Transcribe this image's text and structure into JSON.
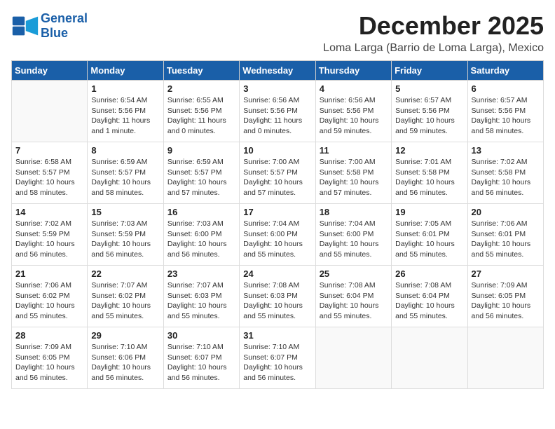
{
  "logo": {
    "text_general": "General",
    "text_blue": "Blue"
  },
  "header": {
    "month": "December 2025",
    "location": "Loma Larga (Barrio de Loma Larga), Mexico"
  },
  "weekdays": [
    "Sunday",
    "Monday",
    "Tuesday",
    "Wednesday",
    "Thursday",
    "Friday",
    "Saturday"
  ],
  "weeks": [
    [
      {
        "day": "",
        "info": ""
      },
      {
        "day": "1",
        "info": "Sunrise: 6:54 AM\nSunset: 5:56 PM\nDaylight: 11 hours\nand 1 minute."
      },
      {
        "day": "2",
        "info": "Sunrise: 6:55 AM\nSunset: 5:56 PM\nDaylight: 11 hours\nand 0 minutes."
      },
      {
        "day": "3",
        "info": "Sunrise: 6:56 AM\nSunset: 5:56 PM\nDaylight: 11 hours\nand 0 minutes."
      },
      {
        "day": "4",
        "info": "Sunrise: 6:56 AM\nSunset: 5:56 PM\nDaylight: 10 hours\nand 59 minutes."
      },
      {
        "day": "5",
        "info": "Sunrise: 6:57 AM\nSunset: 5:56 PM\nDaylight: 10 hours\nand 59 minutes."
      },
      {
        "day": "6",
        "info": "Sunrise: 6:57 AM\nSunset: 5:56 PM\nDaylight: 10 hours\nand 58 minutes."
      }
    ],
    [
      {
        "day": "7",
        "info": "Sunrise: 6:58 AM\nSunset: 5:57 PM\nDaylight: 10 hours\nand 58 minutes."
      },
      {
        "day": "8",
        "info": "Sunrise: 6:59 AM\nSunset: 5:57 PM\nDaylight: 10 hours\nand 58 minutes."
      },
      {
        "day": "9",
        "info": "Sunrise: 6:59 AM\nSunset: 5:57 PM\nDaylight: 10 hours\nand 57 minutes."
      },
      {
        "day": "10",
        "info": "Sunrise: 7:00 AM\nSunset: 5:57 PM\nDaylight: 10 hours\nand 57 minutes."
      },
      {
        "day": "11",
        "info": "Sunrise: 7:00 AM\nSunset: 5:58 PM\nDaylight: 10 hours\nand 57 minutes."
      },
      {
        "day": "12",
        "info": "Sunrise: 7:01 AM\nSunset: 5:58 PM\nDaylight: 10 hours\nand 56 minutes."
      },
      {
        "day": "13",
        "info": "Sunrise: 7:02 AM\nSunset: 5:58 PM\nDaylight: 10 hours\nand 56 minutes."
      }
    ],
    [
      {
        "day": "14",
        "info": "Sunrise: 7:02 AM\nSunset: 5:59 PM\nDaylight: 10 hours\nand 56 minutes."
      },
      {
        "day": "15",
        "info": "Sunrise: 7:03 AM\nSunset: 5:59 PM\nDaylight: 10 hours\nand 56 minutes."
      },
      {
        "day": "16",
        "info": "Sunrise: 7:03 AM\nSunset: 6:00 PM\nDaylight: 10 hours\nand 56 minutes."
      },
      {
        "day": "17",
        "info": "Sunrise: 7:04 AM\nSunset: 6:00 PM\nDaylight: 10 hours\nand 55 minutes."
      },
      {
        "day": "18",
        "info": "Sunrise: 7:04 AM\nSunset: 6:00 PM\nDaylight: 10 hours\nand 55 minutes."
      },
      {
        "day": "19",
        "info": "Sunrise: 7:05 AM\nSunset: 6:01 PM\nDaylight: 10 hours\nand 55 minutes."
      },
      {
        "day": "20",
        "info": "Sunrise: 7:06 AM\nSunset: 6:01 PM\nDaylight: 10 hours\nand 55 minutes."
      }
    ],
    [
      {
        "day": "21",
        "info": "Sunrise: 7:06 AM\nSunset: 6:02 PM\nDaylight: 10 hours\nand 55 minutes."
      },
      {
        "day": "22",
        "info": "Sunrise: 7:07 AM\nSunset: 6:02 PM\nDaylight: 10 hours\nand 55 minutes."
      },
      {
        "day": "23",
        "info": "Sunrise: 7:07 AM\nSunset: 6:03 PM\nDaylight: 10 hours\nand 55 minutes."
      },
      {
        "day": "24",
        "info": "Sunrise: 7:08 AM\nSunset: 6:03 PM\nDaylight: 10 hours\nand 55 minutes."
      },
      {
        "day": "25",
        "info": "Sunrise: 7:08 AM\nSunset: 6:04 PM\nDaylight: 10 hours\nand 55 minutes."
      },
      {
        "day": "26",
        "info": "Sunrise: 7:08 AM\nSunset: 6:04 PM\nDaylight: 10 hours\nand 55 minutes."
      },
      {
        "day": "27",
        "info": "Sunrise: 7:09 AM\nSunset: 6:05 PM\nDaylight: 10 hours\nand 56 minutes."
      }
    ],
    [
      {
        "day": "28",
        "info": "Sunrise: 7:09 AM\nSunset: 6:05 PM\nDaylight: 10 hours\nand 56 minutes."
      },
      {
        "day": "29",
        "info": "Sunrise: 7:10 AM\nSunset: 6:06 PM\nDaylight: 10 hours\nand 56 minutes."
      },
      {
        "day": "30",
        "info": "Sunrise: 7:10 AM\nSunset: 6:07 PM\nDaylight: 10 hours\nand 56 minutes."
      },
      {
        "day": "31",
        "info": "Sunrise: 7:10 AM\nSunset: 6:07 PM\nDaylight: 10 hours\nand 56 minutes."
      },
      {
        "day": "",
        "info": ""
      },
      {
        "day": "",
        "info": ""
      },
      {
        "day": "",
        "info": ""
      }
    ]
  ]
}
